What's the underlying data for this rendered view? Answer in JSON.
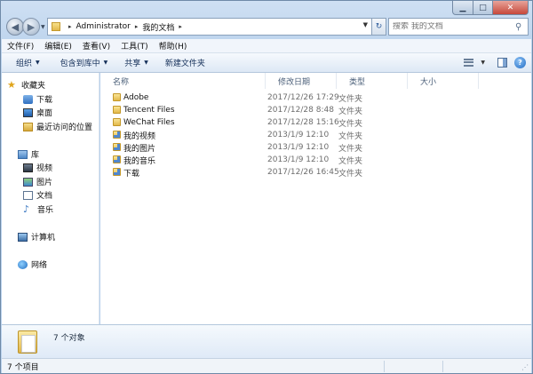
{
  "address_bar": {
    "crumbs": [
      "Administrator",
      "我的文档"
    ]
  },
  "search": {
    "placeholder": "搜索 我的文档"
  },
  "menu": [
    "文件(F)",
    "编辑(E)",
    "查看(V)",
    "工具(T)",
    "帮助(H)"
  ],
  "toolbar": {
    "organize": "组织",
    "include_in_library": "包含到库中",
    "share": "共享",
    "new_folder": "新建文件夹"
  },
  "nav": {
    "favorites": "收藏夹",
    "downloads": "下载",
    "desktop": "桌面",
    "recent": "最近访问的位置",
    "libraries": "库",
    "videos": "视频",
    "pictures": "图片",
    "documents": "文档",
    "music": "音乐",
    "computer": "计算机",
    "network": "网络"
  },
  "columns": {
    "name": "名称",
    "date": "修改日期",
    "type": "类型",
    "size": "大小"
  },
  "files": [
    {
      "name": "Adobe",
      "date": "2017/12/26 17:29",
      "type": "文件夹"
    },
    {
      "name": "Tencent Files",
      "date": "2017/12/28 8:48",
      "type": "文件夹"
    },
    {
      "name": "WeChat Files",
      "date": "2017/12/28 15:16",
      "type": "文件夹"
    },
    {
      "name": "我的视频",
      "date": "2013/1/9 12:10",
      "type": "文件夹"
    },
    {
      "name": "我的图片",
      "date": "2013/1/9 12:10",
      "type": "文件夹"
    },
    {
      "name": "我的音乐",
      "date": "2013/1/9 12:10",
      "type": "文件夹"
    },
    {
      "name": "下载",
      "date": "2017/12/26 16:45",
      "type": "文件夹"
    }
  ],
  "details": {
    "summary": "7 个对象"
  },
  "status": {
    "text": "7 个项目"
  }
}
